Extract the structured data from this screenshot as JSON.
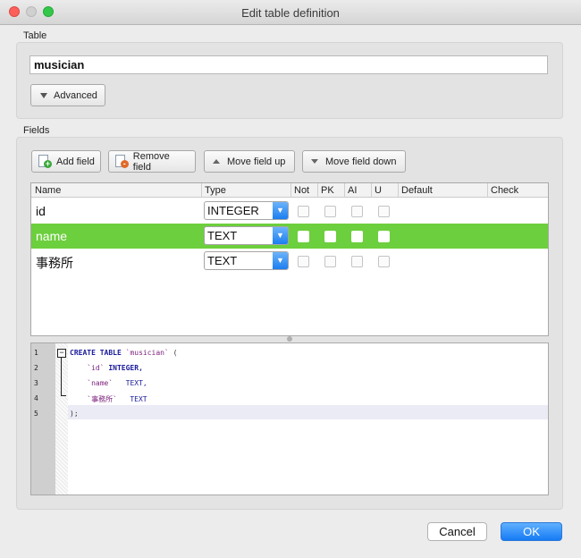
{
  "window": {
    "title": "Edit table definition"
  },
  "table_section": {
    "label": "Table",
    "table_name": "musician",
    "advanced_label": "Advanced"
  },
  "fields_section": {
    "label": "Fields",
    "toolbar": {
      "add_field": "Add field",
      "remove_field": "Remove field",
      "move_up": "Move field up",
      "move_down": "Move field down"
    },
    "columns": [
      "Name",
      "Type",
      "Not",
      "PK",
      "AI",
      "U",
      "Default",
      "Check"
    ],
    "rows": [
      {
        "name": "id",
        "type": "INTEGER",
        "not_null": false,
        "pk": false,
        "ai": false,
        "unique": false,
        "selected": false
      },
      {
        "name": "name",
        "type": "TEXT",
        "not_null": false,
        "pk": false,
        "ai": false,
        "unique": false,
        "selected": true
      },
      {
        "name": "事務所",
        "type": "TEXT",
        "not_null": false,
        "pk": false,
        "ai": false,
        "unique": false,
        "selected": false
      }
    ]
  },
  "sql_preview": {
    "line_numbers": [
      "1",
      "2",
      "3",
      "4",
      "5"
    ],
    "lines": [
      {
        "kw": "CREATE TABLE",
        "ident": " `musician`",
        "rest": " ("
      },
      {
        "kw": "",
        "ident": "    `id`",
        "rest": " INTEGER,",
        "type_bold": true
      },
      {
        "kw": "",
        "ident": "    `name`",
        "rest": "   TEXT,",
        "type_bold": false
      },
      {
        "kw": "",
        "ident": "    `事務所`",
        "rest": "   TEXT",
        "type_bold": false
      },
      {
        "kw": "",
        "ident": "",
        "rest": ");"
      }
    ]
  },
  "buttons": {
    "cancel": "Cancel",
    "ok": "OK"
  },
  "colors": {
    "selection": "#6ccf3d",
    "accent": "#167bf4"
  }
}
